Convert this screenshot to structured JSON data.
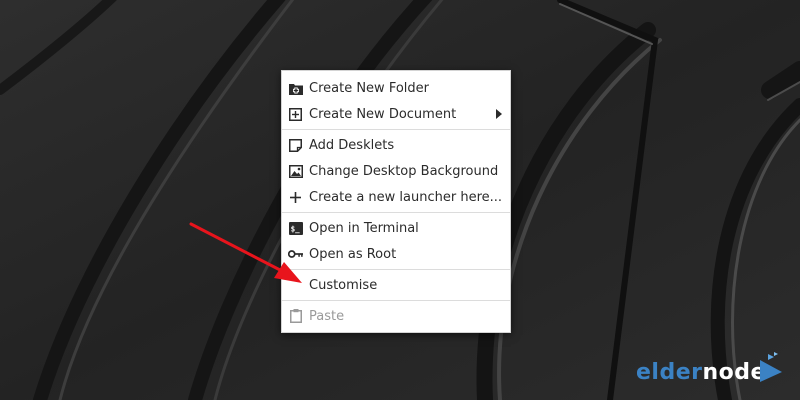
{
  "menu": {
    "items": [
      {
        "label": "Create New Folder",
        "icon": "folder-plus-icon"
      },
      {
        "label": "Create New Document",
        "icon": "document-plus-icon",
        "submenu": true
      },
      {
        "label": "Add Desklets",
        "icon": "desklet-icon"
      },
      {
        "label": "Change Desktop Background",
        "icon": "image-icon"
      },
      {
        "label": "Create a new launcher here...",
        "icon": "plus-icon"
      },
      {
        "label": "Open in Terminal",
        "icon": "terminal-icon"
      },
      {
        "label": "Open as Root",
        "icon": "key-icon"
      },
      {
        "label": "Customise",
        "icon": ""
      },
      {
        "label": "Paste",
        "icon": "clipboard-icon",
        "disabled": true
      }
    ]
  },
  "annotation": {
    "arrow_color": "#e8141c"
  },
  "brand": {
    "part1": "elder",
    "part2": "node",
    "accent": "#3b82c4"
  }
}
